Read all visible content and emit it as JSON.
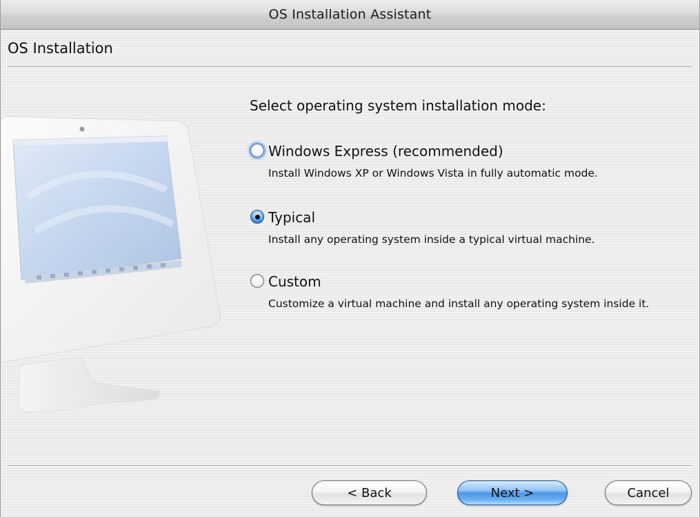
{
  "window": {
    "title": "OS Installation Assistant"
  },
  "page": {
    "heading": "OS Installation"
  },
  "prompt": "Select operating system installation mode:",
  "options": [
    {
      "label": "Windows Express (recommended)",
      "description": "Install Windows XP or Windows Vista in fully automatic mode.",
      "selected": false
    },
    {
      "label": "Typical",
      "description": "Install any operating system inside a typical virtual machine.",
      "selected": true
    },
    {
      "label": "Custom",
      "description": "Customize a virtual machine and install any operating system inside it.",
      "selected": false
    }
  ],
  "buttons": {
    "back": "< Back",
    "next": "Next >",
    "cancel": "Cancel"
  },
  "icons": {
    "illustration": "computer-monitor-illustration",
    "radio": "radio-button-icon"
  },
  "colors": {
    "accent": "#4c96e6",
    "focus_ring": "#8fb7ea"
  }
}
